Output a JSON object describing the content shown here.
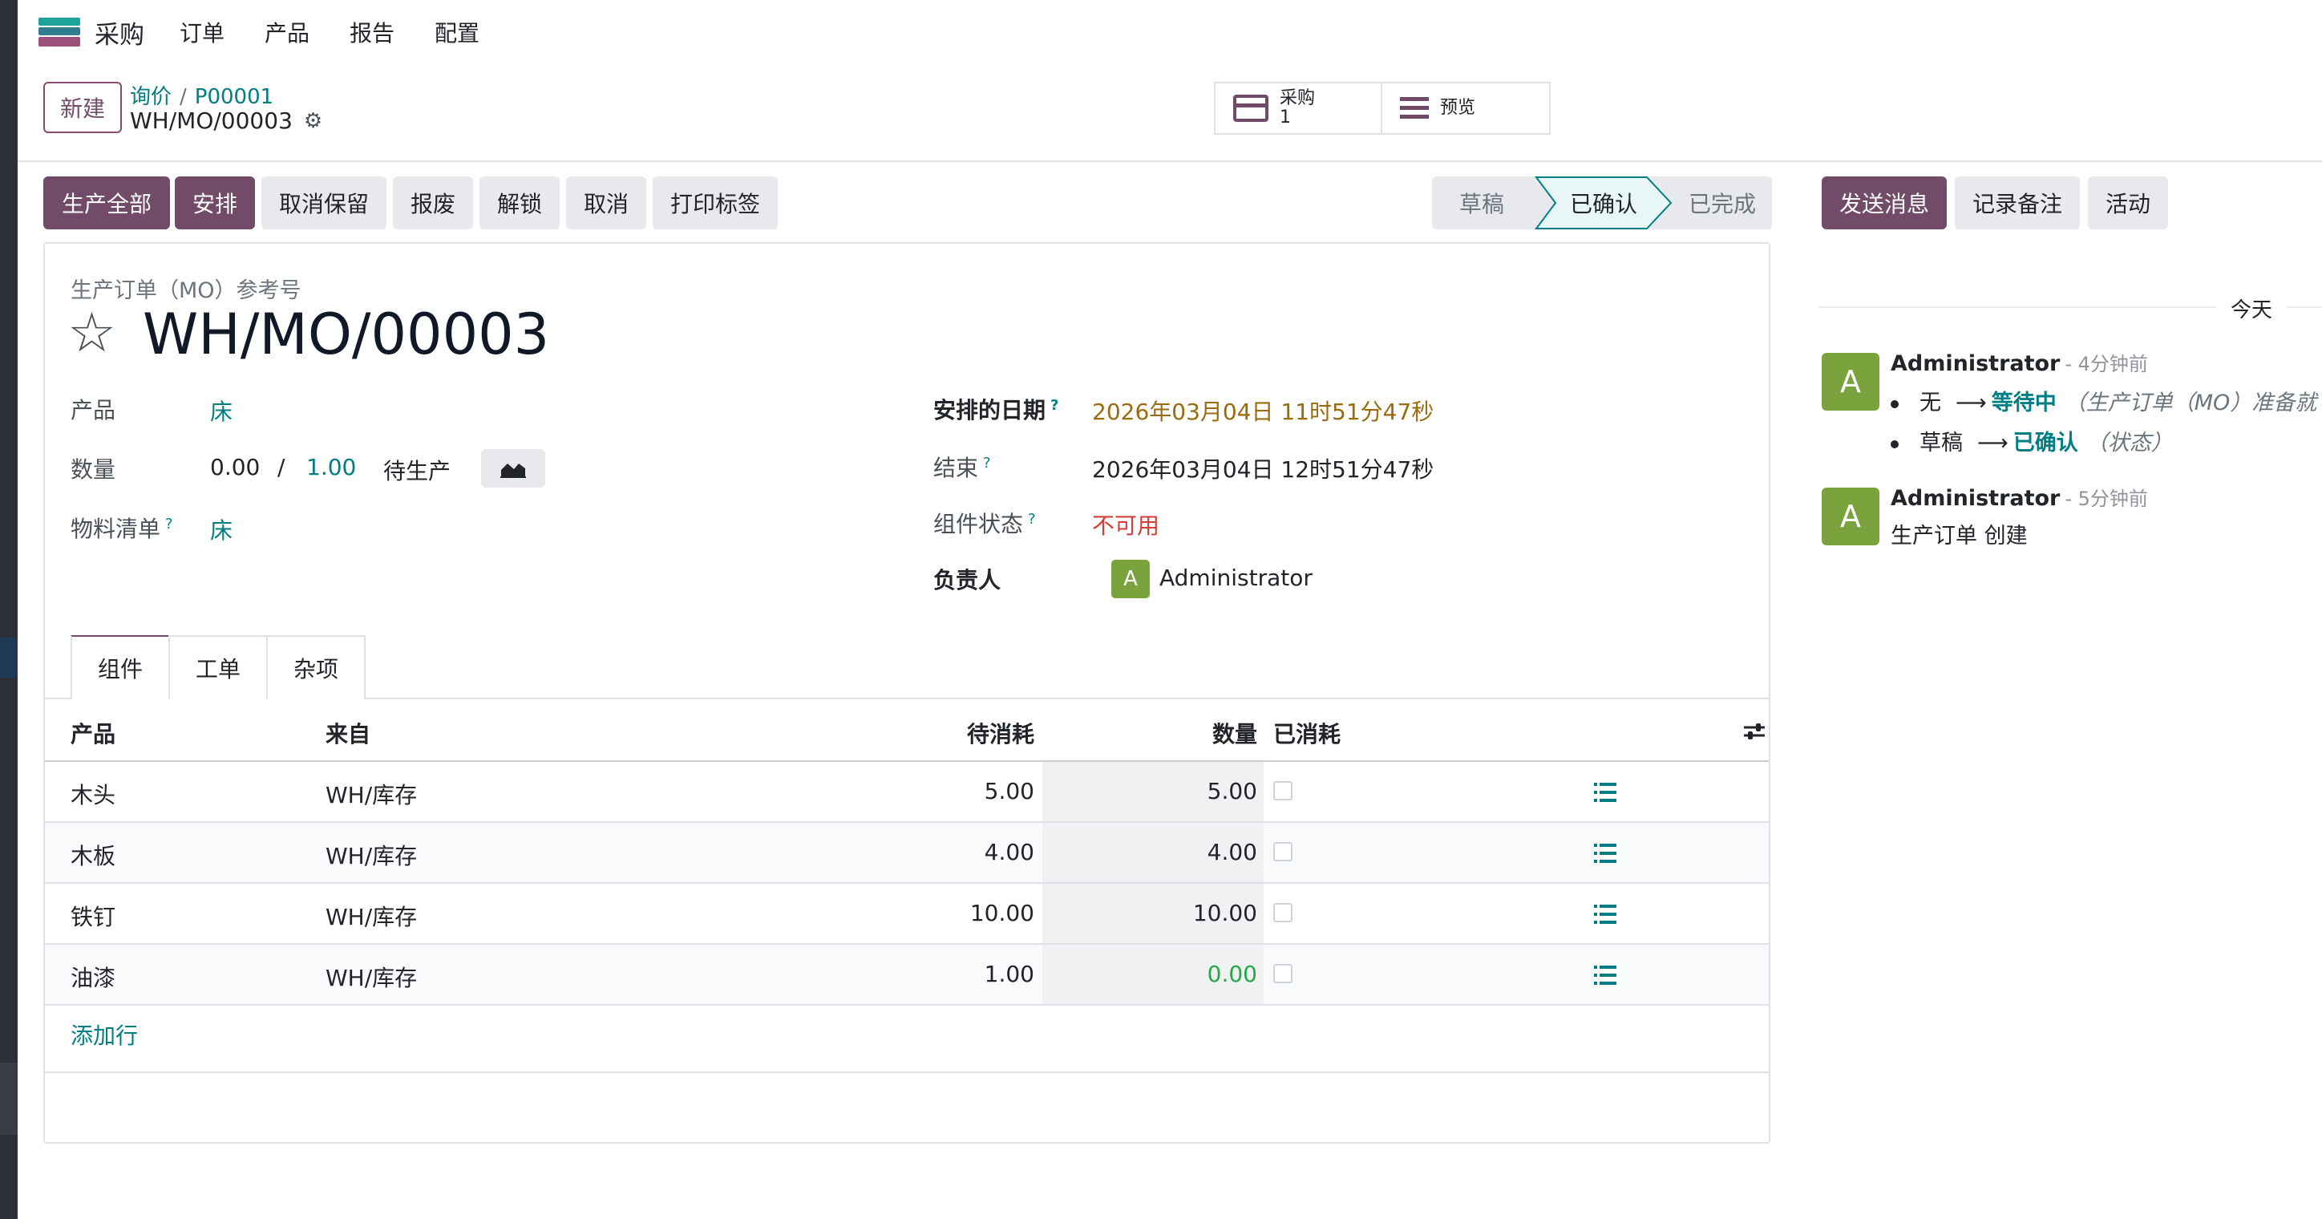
{
  "navbar": {
    "app_name": "采购",
    "menu": [
      "订单",
      "产品",
      "报告",
      "配置"
    ]
  },
  "control_panel": {
    "new_button": "新建",
    "breadcrumb": [
      "询价",
      "P00001"
    ],
    "record_name": "WH/MO/00003",
    "smart_buttons": {
      "purchase_label": "采购",
      "purchase_count": "1",
      "preview_label": "预览"
    }
  },
  "action_buttons": {
    "produce_all": "生产全部",
    "plan": "安排",
    "unreserve": "取消保留",
    "scrap": "报废",
    "unlock": "解锁",
    "cancel": "取消",
    "print_labels": "打印标签"
  },
  "status_steps": [
    "草稿",
    "已确认",
    "已完成"
  ],
  "status_current": "已确认",
  "form": {
    "ref_label": "生产订单（MO）参考号",
    "title": "WH/MO/00003",
    "product_label": "产品",
    "product_value": "床",
    "quantity_label": "数量",
    "qty_produced": "0.00",
    "qty_slash": "/",
    "qty_total": "1.00",
    "qty_status": "待生产",
    "bom_label": "物料清单",
    "bom_value": "床",
    "scheduled_label": "安排的日期",
    "scheduled_value": "2026年03月04日 11时51分47秒",
    "end_label": "结束",
    "end_value": "2026年03月04日 12时51分47秒",
    "component_status_label": "组件状态",
    "component_status_value": "不可用",
    "responsible_label": "负责人",
    "responsible_initial": "A",
    "responsible_value": "Administrator",
    "help_mark": "?"
  },
  "tabs": [
    "组件",
    "工单",
    "杂项"
  ],
  "components_table": {
    "headers": {
      "product": "产品",
      "from": "来自",
      "to_consume": "待消耗",
      "quantity": "数量",
      "consumed": "已消耗"
    },
    "rows": [
      {
        "product": "木头",
        "from": "WH/库存",
        "to_consume": "5.00",
        "quantity": "5.00"
      },
      {
        "product": "木板",
        "from": "WH/库存",
        "to_consume": "4.00",
        "quantity": "4.00"
      },
      {
        "product": "铁钉",
        "from": "WH/库存",
        "to_consume": "10.00",
        "quantity": "10.00"
      },
      {
        "product": "油漆",
        "from": "WH/库存",
        "to_consume": "1.00",
        "quantity": "0.00"
      }
    ],
    "add_line": "添加行"
  },
  "chatter": {
    "send_message": "发送消息",
    "log_note": "记录备注",
    "activities": "活动",
    "today_label": "今天",
    "messages": [
      {
        "initial": "A",
        "author": "Administrator",
        "time": "- 4分钟前",
        "tracking": [
          {
            "old": "无",
            "arrow": "⟶",
            "new": "等待中",
            "field": "（生产订单（MO）准备就"
          },
          {
            "old": "草稿",
            "arrow": "⟶",
            "new": "已确认",
            "field": "（状态）"
          }
        ]
      },
      {
        "initial": "A",
        "author": "Administrator",
        "time": "- 5分钟前",
        "body": "生产订单 创建"
      }
    ]
  },
  "colors": {
    "primary": "#714b67",
    "link": "#017e84",
    "avatar": "#7aa33e",
    "warning_date": "#9a6b0f",
    "danger": "#d23f3a",
    "consumed_zero": "#28a745"
  }
}
